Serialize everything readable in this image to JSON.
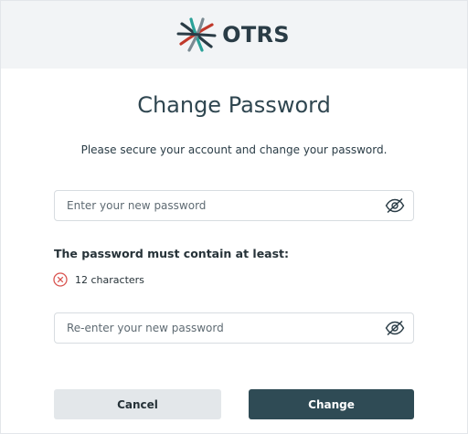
{
  "header": {
    "brand": "OTRS"
  },
  "dialog": {
    "title": "Change Password",
    "subtitle": "Please secure your account and change your password.",
    "new_password": {
      "placeholder": "Enter your new password",
      "value": ""
    },
    "rules_title": "The password must contain at least:",
    "rules": [
      {
        "text": "12 characters",
        "status": "unmet"
      }
    ],
    "confirm_password": {
      "placeholder": "Re-enter your new password",
      "value": ""
    },
    "cancel_label": "Cancel",
    "change_label": "Change"
  },
  "colors": {
    "header_bg": "#f2f4f6",
    "primary_button": "#2f4b55",
    "secondary_button": "#e3e7ea",
    "error": "#d9534f",
    "logo_red": "#c0392b",
    "logo_teal": "#2aa198",
    "logo_dark": "#2a3c46"
  },
  "icons": {
    "visibility_toggle": "eye-slash-icon",
    "rule_status": "x-circle-icon"
  }
}
